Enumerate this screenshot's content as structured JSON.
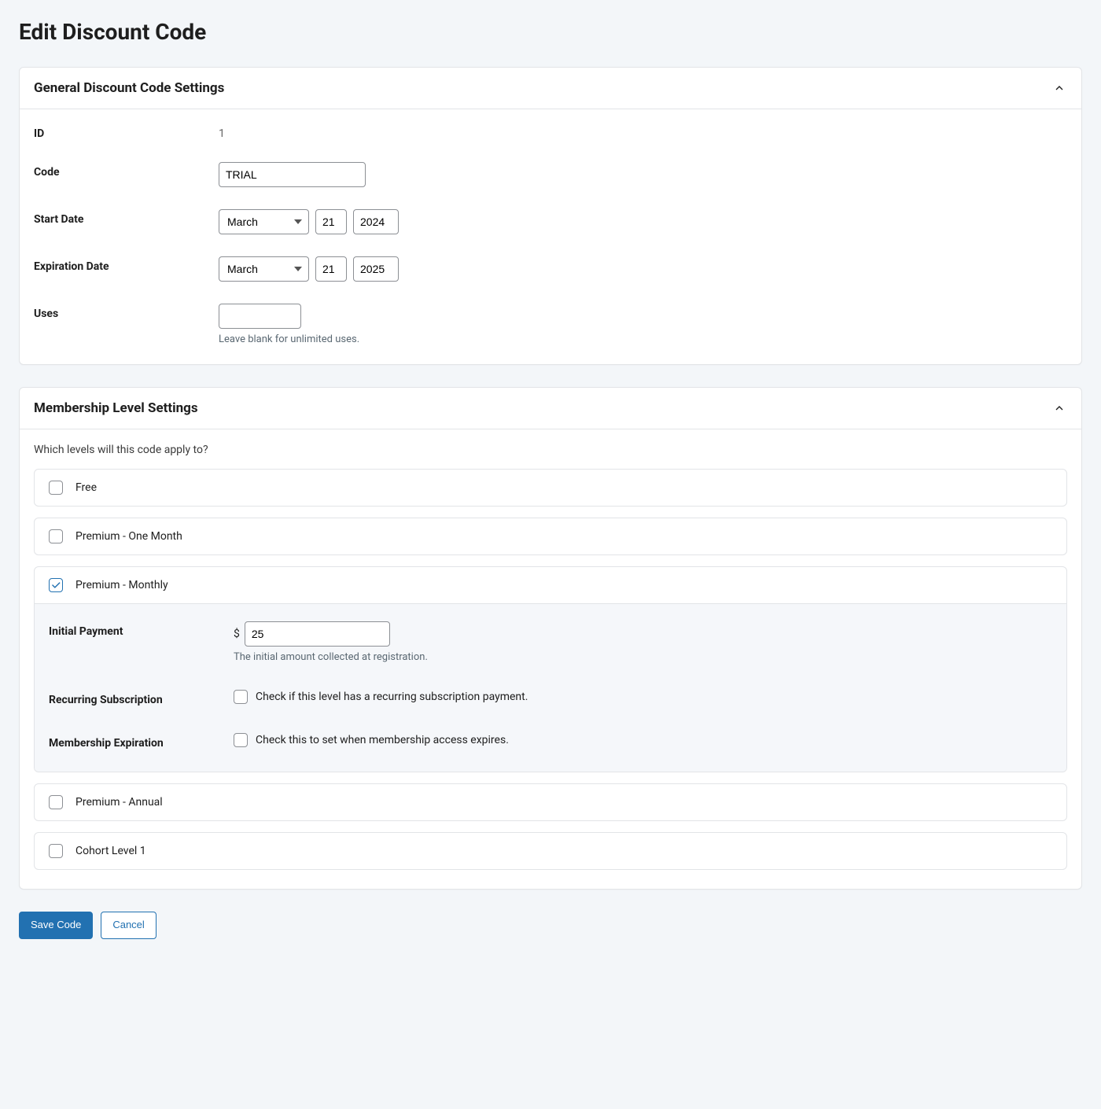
{
  "page_title": "Edit Discount Code",
  "sections": {
    "general": {
      "title": "General Discount Code Settings",
      "fields": {
        "id": {
          "label": "ID",
          "value": "1"
        },
        "code": {
          "label": "Code",
          "value": "TRIAL"
        },
        "start_date": {
          "label": "Start Date",
          "month": "March",
          "day": "21",
          "year": "2024"
        },
        "expiration_date": {
          "label": "Expiration Date",
          "month": "March",
          "day": "21",
          "year": "2025"
        },
        "uses": {
          "label": "Uses",
          "value": "",
          "hint": "Leave blank for unlimited uses."
        }
      }
    },
    "membership": {
      "title": "Membership Level Settings",
      "intro": "Which levels will this code apply to?",
      "levels": [
        {
          "name": "Free",
          "checked": false
        },
        {
          "name": "Premium - One Month",
          "checked": false
        },
        {
          "name": "Premium - Monthly",
          "checked": true
        },
        {
          "name": "Premium - Annual",
          "checked": false
        },
        {
          "name": "Cohort Level 1",
          "checked": false
        }
      ],
      "sub": {
        "initial_payment": {
          "label": "Initial Payment",
          "currency": "$",
          "value": "25",
          "hint": "The initial amount collected at registration."
        },
        "recurring": {
          "label": "Recurring Subscription",
          "text": "Check if this level has a recurring subscription payment.",
          "checked": false
        },
        "expiration": {
          "label": "Membership Expiration",
          "text": "Check this to set when membership access expires.",
          "checked": false
        }
      }
    }
  },
  "actions": {
    "save": "Save Code",
    "cancel": "Cancel"
  }
}
